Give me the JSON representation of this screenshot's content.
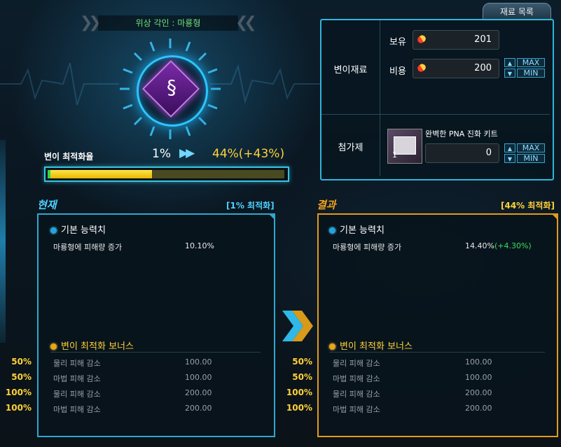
{
  "header": {
    "title": "위상 각인 : 마룡형"
  },
  "emblem": {
    "icon": "dna-helix-icon"
  },
  "optimization": {
    "label": "변이 최적화율",
    "current": "1%",
    "result": "44%(+43%)",
    "current_fraction": 0.01,
    "result_fraction": 0.44
  },
  "materials": {
    "tab_label": "재료 목록",
    "section_label": "변이재료",
    "owned_label": "보유",
    "owned_value": "201",
    "cost_label": "비용",
    "cost_value": "200",
    "max_label": "MAX",
    "min_label": "MIN",
    "additive_label": "첨가제",
    "additive_item_name": "완벽한 PNA 진화 키트",
    "additive_item_count": "1",
    "additive_value": "0"
  },
  "current_panel": {
    "header": "현재",
    "tag": "[1% 최적화]",
    "base_title": "기본 능력치",
    "base_stats": [
      {
        "name": "마룡형에 피해량 증가",
        "value": "10.10%"
      }
    ],
    "bonus_title": "변이 최적화 보너스",
    "bonus": [
      {
        "pct": "50%",
        "name": "물리 피해 감소",
        "value": "100.00"
      },
      {
        "pct": "50%",
        "name": "마법 피해 감소",
        "value": "100.00"
      },
      {
        "pct": "100%",
        "name": "물리 피해 감소",
        "value": "200.00"
      },
      {
        "pct": "100%",
        "name": "마법 피해 감소",
        "value": "200.00"
      }
    ]
  },
  "result_panel": {
    "header": "결과",
    "tag": "[44% 최적화]",
    "base_title": "기본 능력치",
    "base_stats": [
      {
        "name": "마룡형에 피해량 증가",
        "value": "14.40%",
        "delta": "(+4.30%)"
      }
    ],
    "bonus_title": "변이 최적화 보너스",
    "bonus": [
      {
        "pct": "50%",
        "name": "물리 피해 감소",
        "value": "100.00"
      },
      {
        "pct": "50%",
        "name": "마법 피해 감소",
        "value": "100.00"
      },
      {
        "pct": "100%",
        "name": "물리 피해 감소",
        "value": "200.00"
      },
      {
        "pct": "100%",
        "name": "마법 피해 감소",
        "value": "200.00"
      }
    ]
  },
  "colors": {
    "accent_blue": "#2fa8d0",
    "accent_gold": "#e59a1a",
    "value_yellow": "#ffd23a",
    "delta_green": "#36e05a"
  }
}
